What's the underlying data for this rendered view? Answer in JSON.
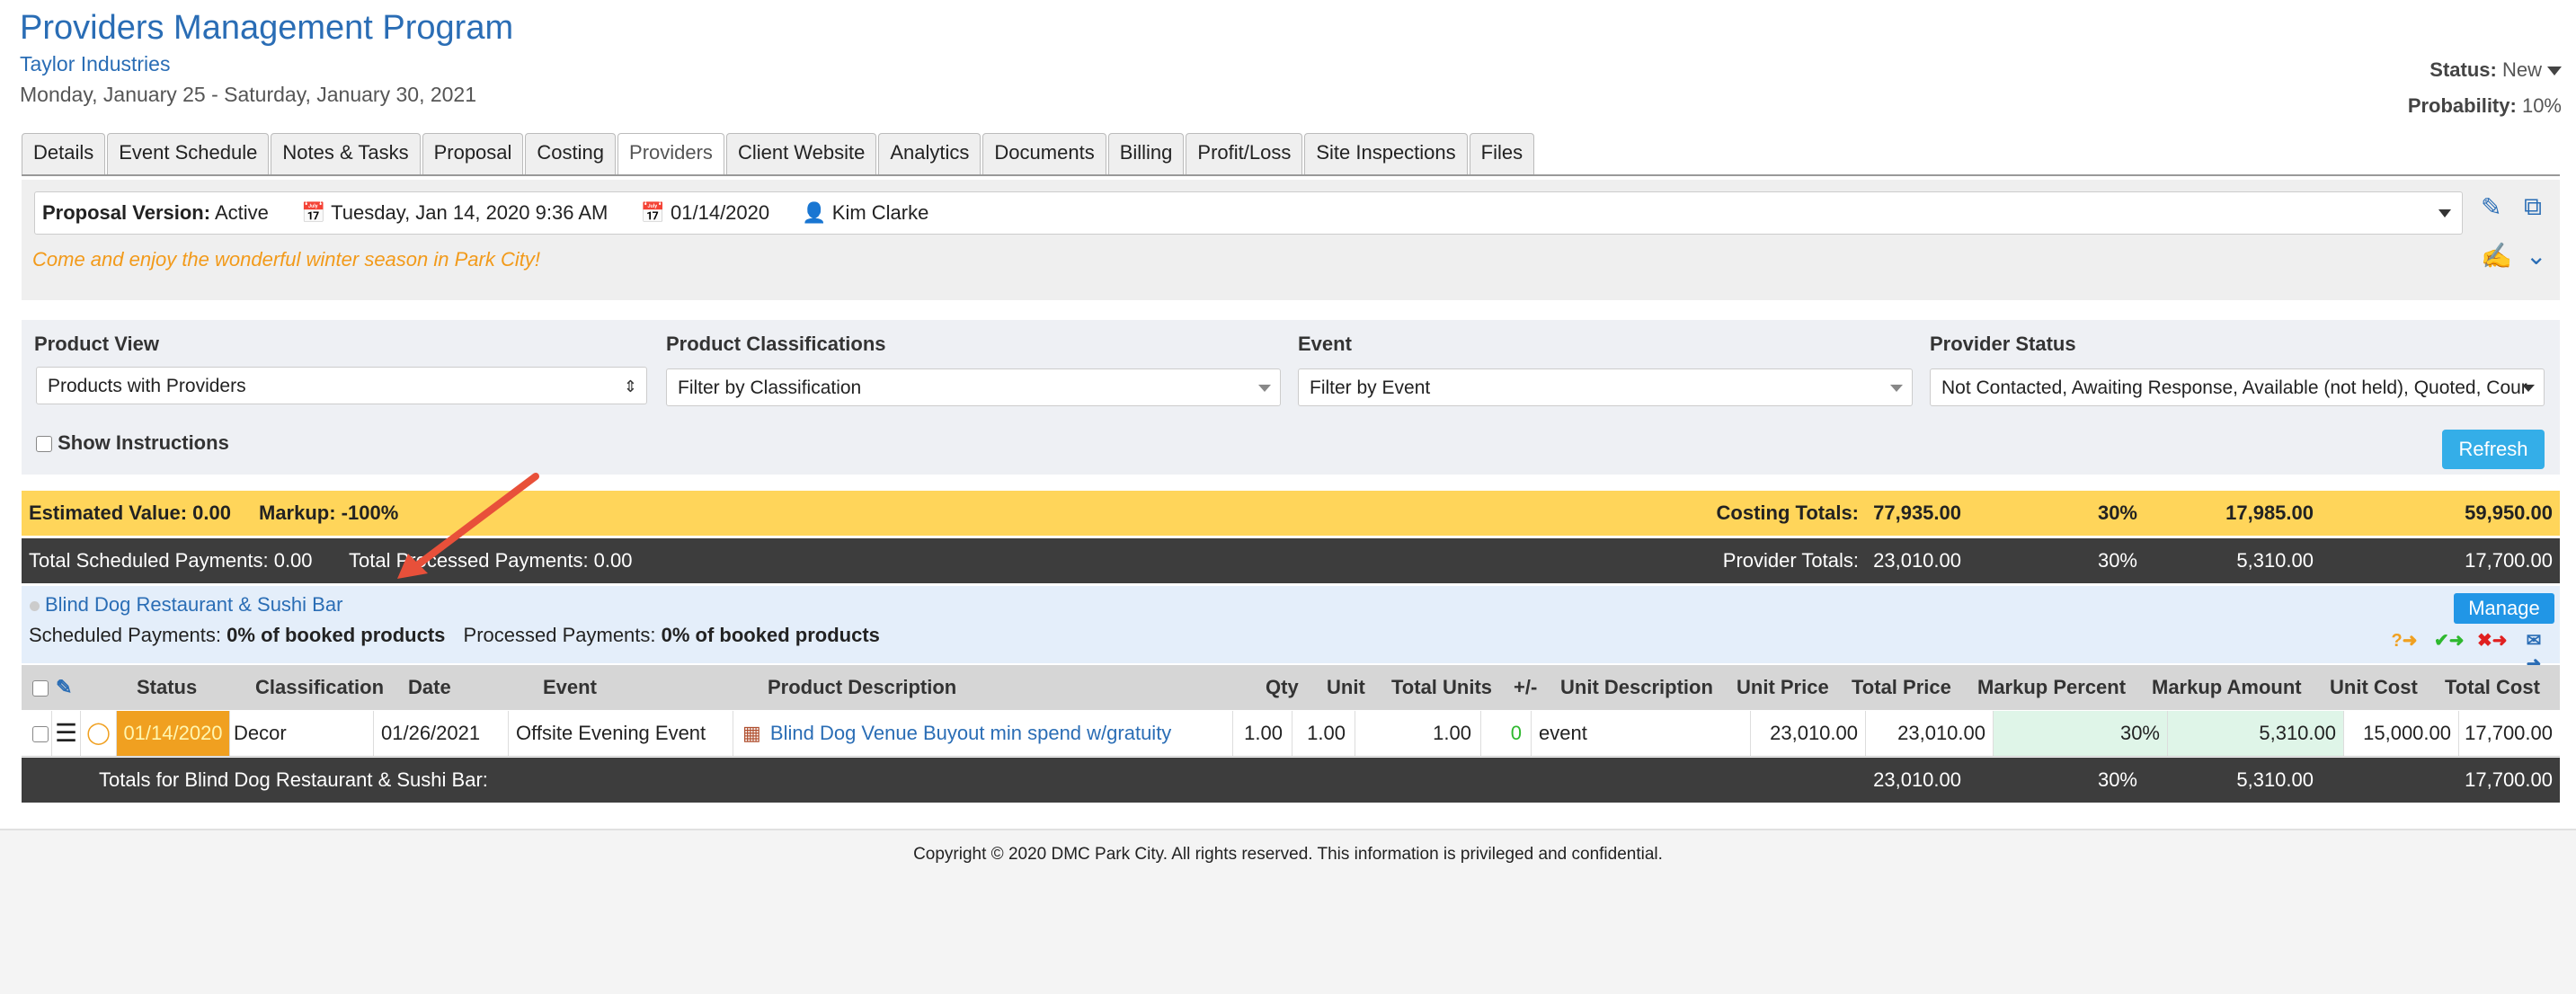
{
  "header": {
    "title": "Providers Management Program",
    "client": "Taylor Industries",
    "dates": "Monday, January 25 - Saturday, January 30, 2021",
    "status_label": "Status:",
    "status_value": "New",
    "probability_label": "Probability:",
    "probability_value": "10%"
  },
  "tabs": [
    "Details",
    "Event Schedule",
    "Notes & Tasks",
    "Proposal",
    "Costing",
    "Providers",
    "Client Website",
    "Analytics",
    "Documents",
    "Billing",
    "Profit/Loss",
    "Site Inspections",
    "Files"
  ],
  "active_tab": "Providers",
  "proposal": {
    "version_label": "Proposal Version:",
    "version_value": "Active",
    "created": "Tuesday, Jan 14, 2020 9:36 AM",
    "date": "01/14/2020",
    "owner": "Kim Clarke",
    "tagline": "Come and enjoy the wonderful winter season in Park City!"
  },
  "filters": {
    "product_view_label": "Product View",
    "product_view_value": "Products with Providers",
    "classification_label": "Product Classifications",
    "classification_placeholder": "Filter by Classification",
    "event_label": "Event",
    "event_placeholder": "Filter by Event",
    "provider_status_label": "Provider Status",
    "provider_status_value": "Not Contacted, Awaiting Response, Available (not held), Quoted, Cour",
    "show_instructions": "Show Instructions",
    "refresh": "Refresh"
  },
  "summary": {
    "estimated_value": "Estimated Value: 0.00",
    "markup": "Markup: -100%",
    "costing_totals_label": "Costing Totals:",
    "costing_totals": [
      "77,935.00",
      "30%",
      "17,985.00",
      "59,950.00"
    ],
    "scheduled_payments": "Total Scheduled Payments: 0.00",
    "processed_payments": "Total Processed Payments: 0.00",
    "provider_totals_label": "Provider Totals:",
    "provider_totals": [
      "23,010.00",
      "30%",
      "5,310.00",
      "17,700.00"
    ]
  },
  "vendor": {
    "name": "Blind Dog Restaurant & Sushi Bar",
    "manage": "Manage",
    "scheduled_label": "Scheduled Payments:",
    "scheduled_value": "0% of booked products",
    "processed_label": "Processed Payments:",
    "processed_value": "0% of booked products"
  },
  "table": {
    "columns": [
      "Status",
      "Classification",
      "Date",
      "Event",
      "Product Description",
      "Qty",
      "Unit",
      "Total Units",
      "+/-",
      "Unit Description",
      "Unit Price",
      "Total Price",
      "Markup Percent",
      "Markup Amount",
      "Unit Cost",
      "Total Cost"
    ],
    "row": {
      "status_date": "01/14/2020",
      "classification": "Decor",
      "date": "01/26/2021",
      "event": "Offsite Evening Event",
      "product": "Blind Dog Venue Buyout min spend w/gratuity",
      "qty": "1.00",
      "unit": "1.00",
      "total_units": "1.00",
      "plus_minus": "0",
      "unit_description": "event",
      "unit_price": "23,010.00",
      "total_price": "23,010.00",
      "markup_percent": "30%",
      "markup_amount": "5,310.00",
      "unit_cost": "15,000.00",
      "total_cost": "17,700.00"
    },
    "totals_label": "Totals for Blind Dog Restaurant & Sushi Bar:",
    "totals": [
      "23,010.00",
      "30%",
      "5,310.00",
      "17,700.00"
    ]
  },
  "footer": "Copyright © 2020 DMC Park City. All rights reserved. This information is privileged and confidential.",
  "colors": {
    "link_blue": "#2a6db5",
    "summary_yellow": "#ffd55a",
    "dark_bar": "#3d3d3d",
    "markup_green": "#dff5e8",
    "status_orange": "#f0a020",
    "refresh_blue": "#34aee8"
  }
}
